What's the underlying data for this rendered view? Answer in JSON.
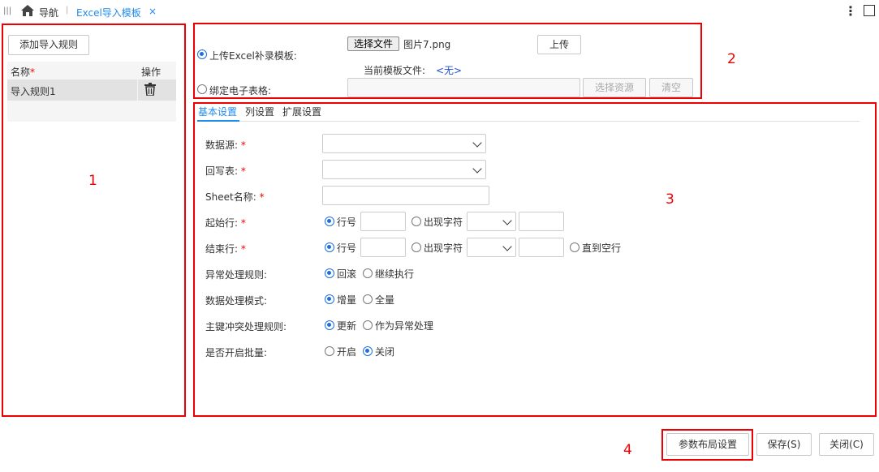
{
  "topbar": {
    "nav_label": "导航",
    "tab_label": "Excel导入模板",
    "tab_close": "×"
  },
  "left": {
    "add_rule_button": "添加导入规则",
    "col_name": "名称",
    "col_name_required": "*",
    "col_ops": "操作",
    "rules": [
      {
        "name": "导入规则1"
      }
    ],
    "marker": "1"
  },
  "upload": {
    "upload_excel_label": "上传Excel补录模板:",
    "choose_file_button": "选择文件",
    "file_name": "图片7.png",
    "upload_button": "上传",
    "current_template_label": "当前模板文件:",
    "current_template_value": "<无>",
    "bind_sheet_label": "绑定电子表格:",
    "choose_resource_button": "选择资源",
    "clear_button": "清空",
    "marker": "2"
  },
  "tabs": [
    {
      "label": "基本设置",
      "active": true
    },
    {
      "label": "列设置"
    },
    {
      "label": "扩展设置"
    }
  ],
  "form": {
    "marker": "3",
    "datasource_label": "数据源:",
    "writeback_label": "回写表:",
    "sheet_label": "Sheet名称:",
    "required": "*",
    "start_row_label": "起始行:",
    "end_row_label": "结束行:",
    "opt_row_no": "行号",
    "opt_char": "出现字符",
    "opt_until_empty": "直到空行",
    "error_rule_label": "异常处理规则:",
    "opt_rollback": "回滚",
    "opt_continue": "继续执行",
    "data_mode_label": "数据处理模式:",
    "opt_incremental": "增量",
    "opt_full": "全量",
    "pk_conflict_label": "主键冲突处理规则:",
    "opt_update": "更新",
    "opt_as_error": "作为异常处理",
    "batch_label": "是否开启批量:",
    "opt_on": "开启",
    "opt_off": "关闭"
  },
  "footer": {
    "marker": "4",
    "param_layout_button": "参数布局设置",
    "save_button": "保存(S)",
    "close_button": "关闭(C)"
  },
  "colors": {
    "accent": "#1f8ceb",
    "red_marker": "#ee0000",
    "radio_selected": "#1f6fe0"
  }
}
